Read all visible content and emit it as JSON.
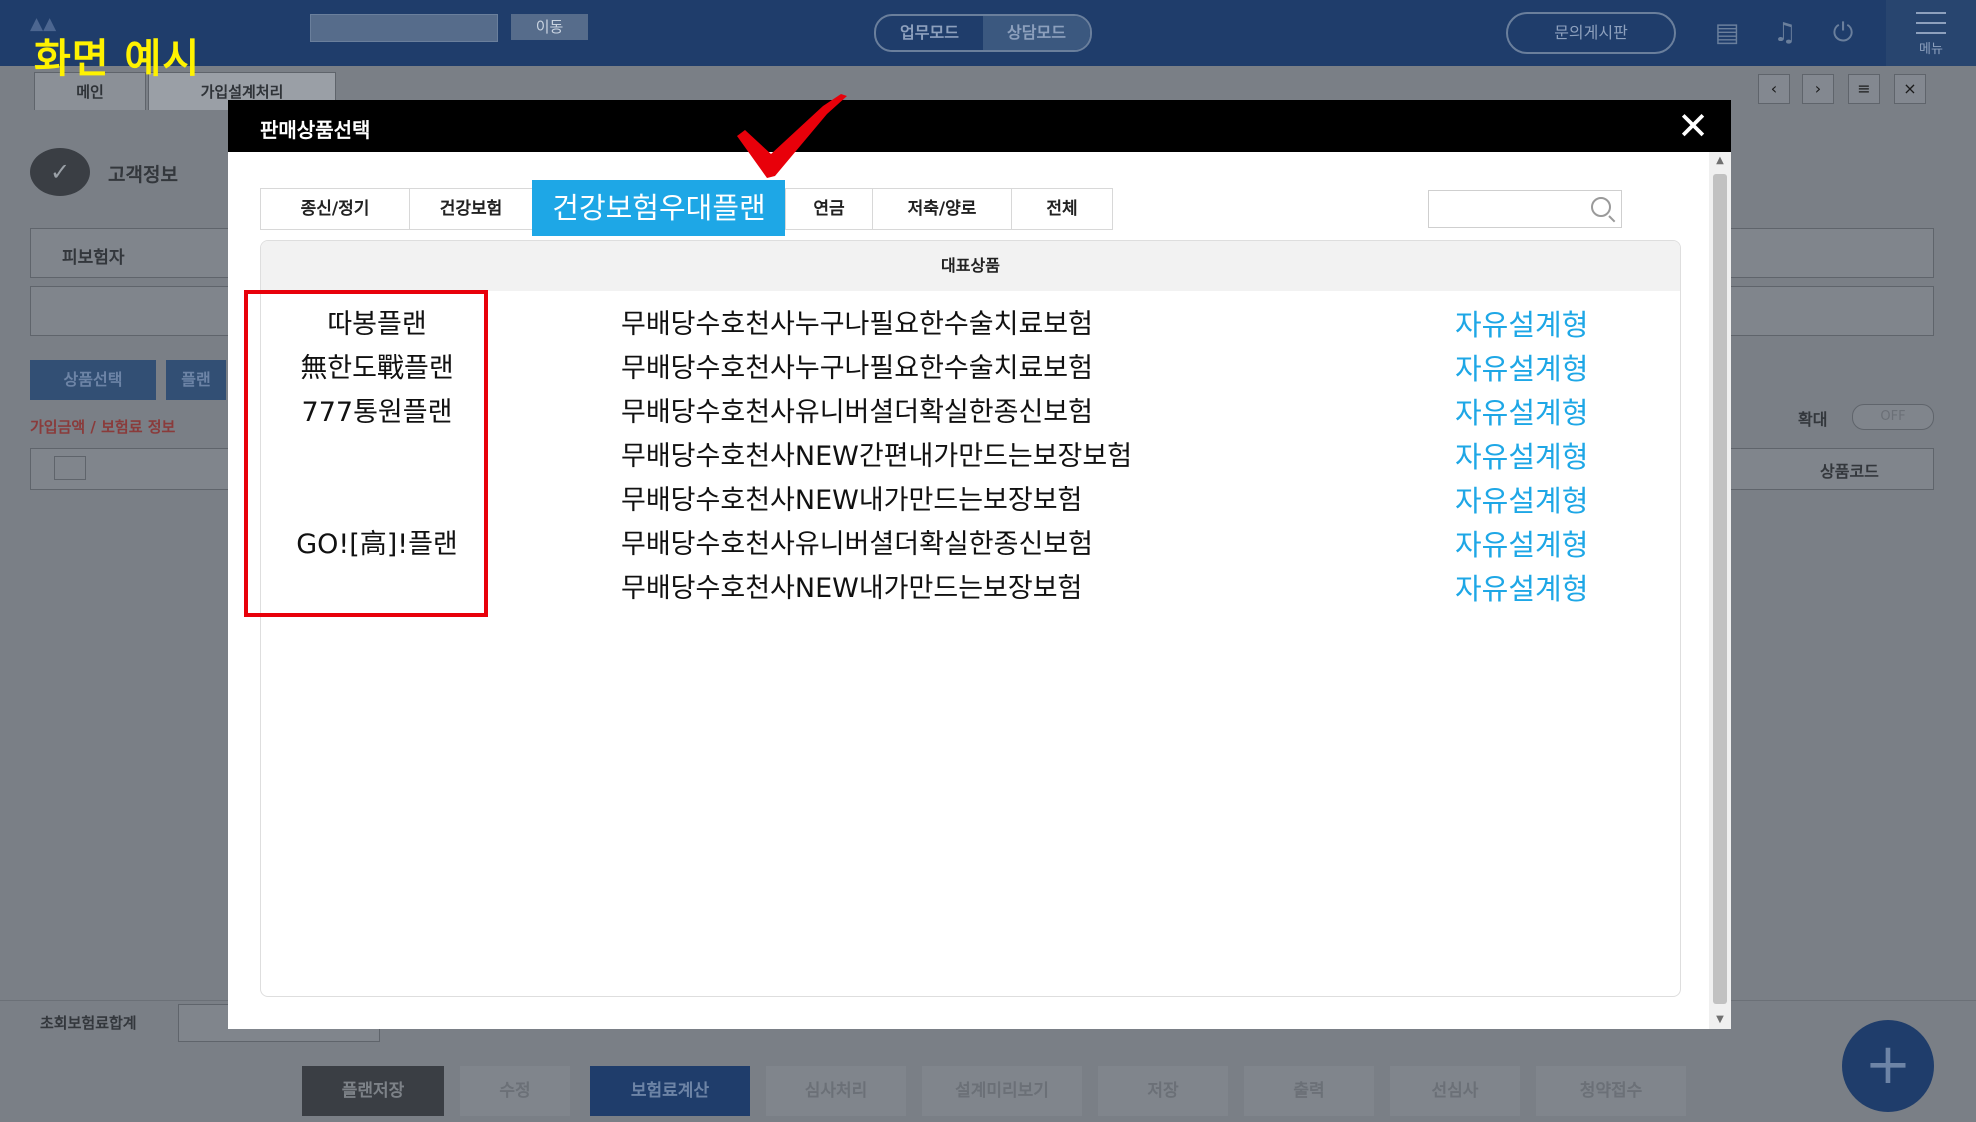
{
  "demo_label": "화면 예시",
  "app": {
    "title": "",
    "move_button": "이동",
    "modes": [
      "업무모드",
      "상담모드"
    ],
    "qa_board": "문의게시판",
    "menu_label": "메뉴"
  },
  "page_tabs": [
    "메인",
    "가입설계처리"
  ],
  "background": {
    "customer_info": "고객정보",
    "insured": "피보험자",
    "product_select_btn": "상품선택",
    "plan_btn": "플랜",
    "amount_info": "가입금액 / 보험료 정보",
    "zoom_label": "확대",
    "zoom_state": "OFF",
    "product_code": "상품코드",
    "first_premium_total": "초회보험료합계",
    "bottom_buttons": [
      "플랜저장",
      "수정",
      "보험료계산",
      "심사처리",
      "설계미리보기",
      "저장",
      "출력",
      "선심사",
      "청약접수"
    ]
  },
  "modal": {
    "title": "판매상품선택",
    "tabs": [
      "종신/정기",
      "건강보험",
      "건강보험우대플랜",
      "연금",
      "저축/양로",
      "전체"
    ],
    "active_tab": "건강보험우대플랜",
    "search_placeholder": "",
    "list_header": "대표상품",
    "rows": [
      {
        "plan": "따봉플랜",
        "name": "무배당수호천사누구나필요한수술치료보험",
        "type": "자유설계형"
      },
      {
        "plan": "無한도戰플랜",
        "name": "무배당수호천사누구나필요한수술치료보험",
        "type": "자유설계형"
      },
      {
        "plan": "777통원플랜",
        "name": "무배당수호천사유니버셜더확실한종신보험",
        "type": "자유설계형"
      },
      {
        "plan": "",
        "name": "무배당수호천사NEW간편내가만드는보장보험",
        "type": "자유설계형"
      },
      {
        "plan": "",
        "name": "무배당수호천사NEW내가만드는보장보험",
        "type": "자유설계형"
      },
      {
        "plan": "GO![高]!플랜",
        "name": "무배당수호천사유니버셜더확실한종신보험",
        "type": "자유설계형"
      },
      {
        "plan": "",
        "name": "무배당수호천사NEW내가만드는보장보험",
        "type": "자유설계형"
      }
    ]
  },
  "colors": {
    "active_tab": "#1ea7e6",
    "type_link": "#1ea7e6",
    "annotation_red": "#e8000a",
    "demo_label": "#fff200",
    "header_bar": "#1f3d6b"
  },
  "icons": [
    "calendar-icon",
    "bell-icon",
    "power-icon",
    "menu-icon",
    "close-icon",
    "search-icon",
    "plus-icon",
    "checkmark-annotation-icon"
  ]
}
